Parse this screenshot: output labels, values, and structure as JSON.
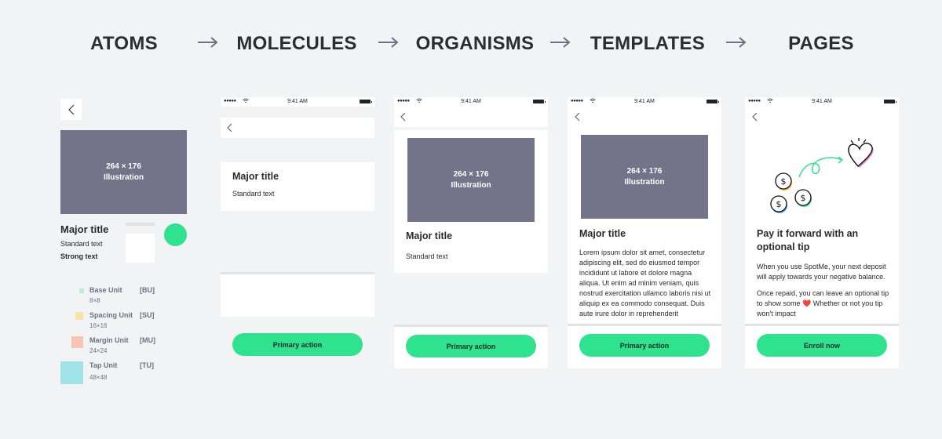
{
  "stages": [
    {
      "label": "ATOMS"
    },
    {
      "label": "MOLECULES"
    },
    {
      "label": "ORGANISMS"
    },
    {
      "label": "TEMPLATES"
    },
    {
      "label": "PAGES"
    }
  ],
  "arrow_icon": "arrow-right",
  "colors": {
    "background": "#f2f3f5",
    "illustration": "#737389",
    "primary": "#2ee28e",
    "heading": "#2d2d30",
    "muted": "#6f6f82"
  },
  "illustration": {
    "size": "264 × 176",
    "label": "Illustration"
  },
  "atoms": {
    "major_title": "Major title",
    "standard_text": "Standard text",
    "strong_text": "Strong text",
    "units": [
      {
        "name": "Base Unit",
        "abbr": "[BU]",
        "size": "8×8",
        "color": "#b9ecd6"
      },
      {
        "name": "Spacing Unit",
        "abbr": "[SU]",
        "size": "16×16",
        "color": "#f8e3a5"
      },
      {
        "name": "Margin Unit",
        "abbr": "[MU]",
        "size": "24×24",
        "color": "#f7c4b6"
      },
      {
        "name": "Tap Unit",
        "abbr": "[TU]",
        "size": "48×48",
        "color": "#9fe3e8"
      }
    ]
  },
  "statusbar": {
    "signal": "●●●●●",
    "time": "9:41 AM"
  },
  "molecules": {
    "major_title": "Major title",
    "standard_text": "Standard text",
    "primary_action": "Primary action"
  },
  "organisms": {
    "major_title": "Major title",
    "standard_text": "Standard text",
    "primary_action": "Primary action"
  },
  "templates": {
    "major_title": "Major title",
    "body": "Lorem ipsum dolor sit amet, consectetur adipiscing elit, sed do eiusmod tempor incididunt ut labore et dolore magna aliqua. Ut enim ad minim veniam, quis nostrud exercitation ullamco laboris nisi ut aliquip ex ea commodo consequat. Duis aute irure dolor in reprehenderit",
    "primary_action": "Primary action"
  },
  "pages": {
    "title": "Pay it forward with an optional tip",
    "para1": "When you use SpotMe, your next deposit will apply towards your negative balance.",
    "para2": "Once repaid, you can leave an optional tip to show some ❤️ Whether or not you tip won't impact",
    "cta": "Enroll now"
  }
}
